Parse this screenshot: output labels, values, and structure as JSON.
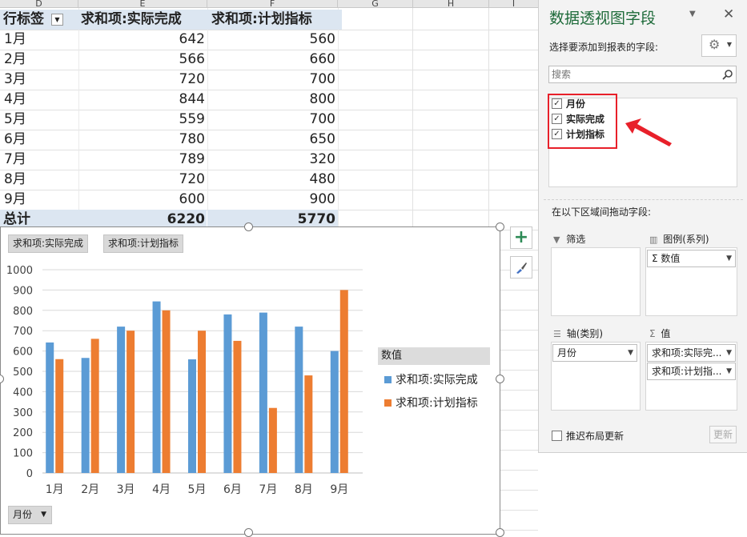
{
  "columns": [
    "D",
    "E",
    "F",
    "G",
    "H",
    "I"
  ],
  "pivot": {
    "headers": [
      "行标签",
      "求和项:实际完成",
      "求和项:计划指标"
    ],
    "rows": [
      {
        "label": "1月",
        "actual": "642",
        "plan": "560"
      },
      {
        "label": "2月",
        "actual": "566",
        "plan": "660"
      },
      {
        "label": "3月",
        "actual": "720",
        "plan": "700"
      },
      {
        "label": "4月",
        "actual": "844",
        "plan": "800"
      },
      {
        "label": "5月",
        "actual": "559",
        "plan": "700"
      },
      {
        "label": "6月",
        "actual": "780",
        "plan": "650"
      },
      {
        "label": "7月",
        "actual": "789",
        "plan": "320"
      },
      {
        "label": "8月",
        "actual": "720",
        "plan": "480"
      },
      {
        "label": "9月",
        "actual": "600",
        "plan": "900"
      }
    ],
    "total": {
      "label": "总计",
      "actual": "6220",
      "plan": "5770"
    }
  },
  "chart": {
    "value_buttons": [
      "求和项:实际完成",
      "求和项:计划指标"
    ],
    "axis_button": "月份",
    "legend_title": "数值",
    "legend": [
      "求和项:实际完成",
      "求和项:计划指标"
    ],
    "colors": {
      "actual": "#5b9bd5",
      "plan": "#ed7d31"
    }
  },
  "chart_data": {
    "type": "bar",
    "categories": [
      "1月",
      "2月",
      "3月",
      "4月",
      "5月",
      "6月",
      "7月",
      "8月",
      "9月"
    ],
    "series": [
      {
        "name": "求和项:实际完成",
        "values": [
          642,
          566,
          720,
          844,
          559,
          780,
          789,
          720,
          600
        ]
      },
      {
        "name": "求和项:计划指标",
        "values": [
          560,
          660,
          700,
          800,
          700,
          650,
          320,
          480,
          900
        ]
      }
    ],
    "ylim": [
      0,
      1000
    ],
    "yticks": [
      "0",
      "100",
      "200",
      "300",
      "400",
      "500",
      "600",
      "700",
      "800",
      "900",
      "1000"
    ],
    "grid": true,
    "legend_position": "right"
  },
  "pane": {
    "title": "数据透视图字段",
    "choose_label": "选择要添加到报表的字段:",
    "search_placeholder": "搜索",
    "fields": [
      {
        "label": "月份",
        "checked": true
      },
      {
        "label": "实际完成",
        "checked": true
      },
      {
        "label": "计划指标",
        "checked": true
      }
    ],
    "drag_label": "在以下区域间拖动字段:",
    "zones": {
      "filter": "筛选",
      "legend": "图例(系列)",
      "axis": "轴(类别)",
      "values": "值"
    },
    "legend_item": "Σ 数值",
    "axis_item": "月份",
    "value_items": [
      "求和项:实际完...",
      "求和项:计划指..."
    ],
    "defer_label": "推迟布局更新",
    "update_label": "更新"
  },
  "icons": [
    "dropdown-icon",
    "plus-icon",
    "brush-icon",
    "gear-icon",
    "search-icon",
    "close-icon",
    "filter-icon",
    "columns-icon",
    "rows-icon",
    "sigma-icon",
    "arrow-annotation-icon"
  ]
}
